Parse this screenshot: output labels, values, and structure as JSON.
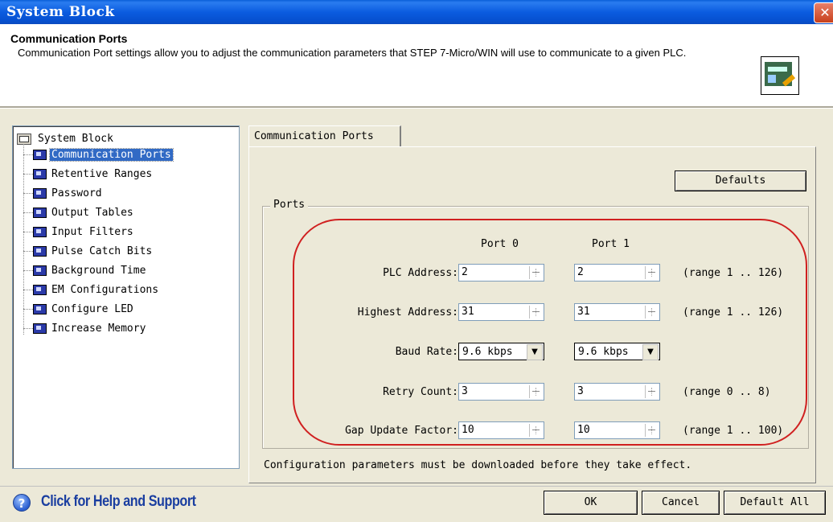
{
  "window": {
    "title": "System Block",
    "close_glyph": "✕"
  },
  "header": {
    "title": "Communication Ports",
    "description": "Communication Port settings allow you to adjust the communication parameters that STEP 7-Micro/WIN will use to communicate to a given PLC.",
    "icon": "communication-ports-icon"
  },
  "tree": {
    "root": "System Block",
    "items": [
      {
        "label": "Communication Ports",
        "selected": true
      },
      {
        "label": "Retentive Ranges"
      },
      {
        "label": "Password"
      },
      {
        "label": "Output Tables"
      },
      {
        "label": "Input Filters"
      },
      {
        "label": "Pulse Catch Bits"
      },
      {
        "label": "Background Time"
      },
      {
        "label": "EM Configurations"
      },
      {
        "label": "Configure LED"
      },
      {
        "label": "Increase Memory"
      }
    ]
  },
  "tab": {
    "label": "Communication Ports"
  },
  "buttons": {
    "defaults": "Defaults",
    "ok": "OK",
    "cancel": "Cancel",
    "default_all": "Default All"
  },
  "ports": {
    "group_title": "Ports",
    "col0": "Port 0",
    "col1": "Port 1",
    "rows": [
      {
        "label": "PLC Address:",
        "port0": "2",
        "port1": "2",
        "range": "(range 1 .. 126)"
      },
      {
        "label": "Highest Address:",
        "port0": "31",
        "port1": "31",
        "range": "(range 1 .. 126)"
      },
      {
        "label": "Baud Rate:",
        "port0": "9.6 kbps",
        "port1": "9.6 kbps",
        "range": ""
      },
      {
        "label": "Retry Count:",
        "port0": "3",
        "port1": "3",
        "range": "(range 0 .. 8)"
      },
      {
        "label": "Gap Update Factor:",
        "port0": "10",
        "port1": "10",
        "range": "(range 1 .. 100)"
      }
    ]
  },
  "note": "Configuration parameters must be downloaded before they take effect.",
  "help": {
    "label": "Click for Help and Support",
    "icon": "help-icon"
  },
  "colors": {
    "title_bar": "#0a5fd8",
    "selection": "#316ac5",
    "highlight_ellipse": "#d02020",
    "help_text": "#1a3ea0"
  }
}
